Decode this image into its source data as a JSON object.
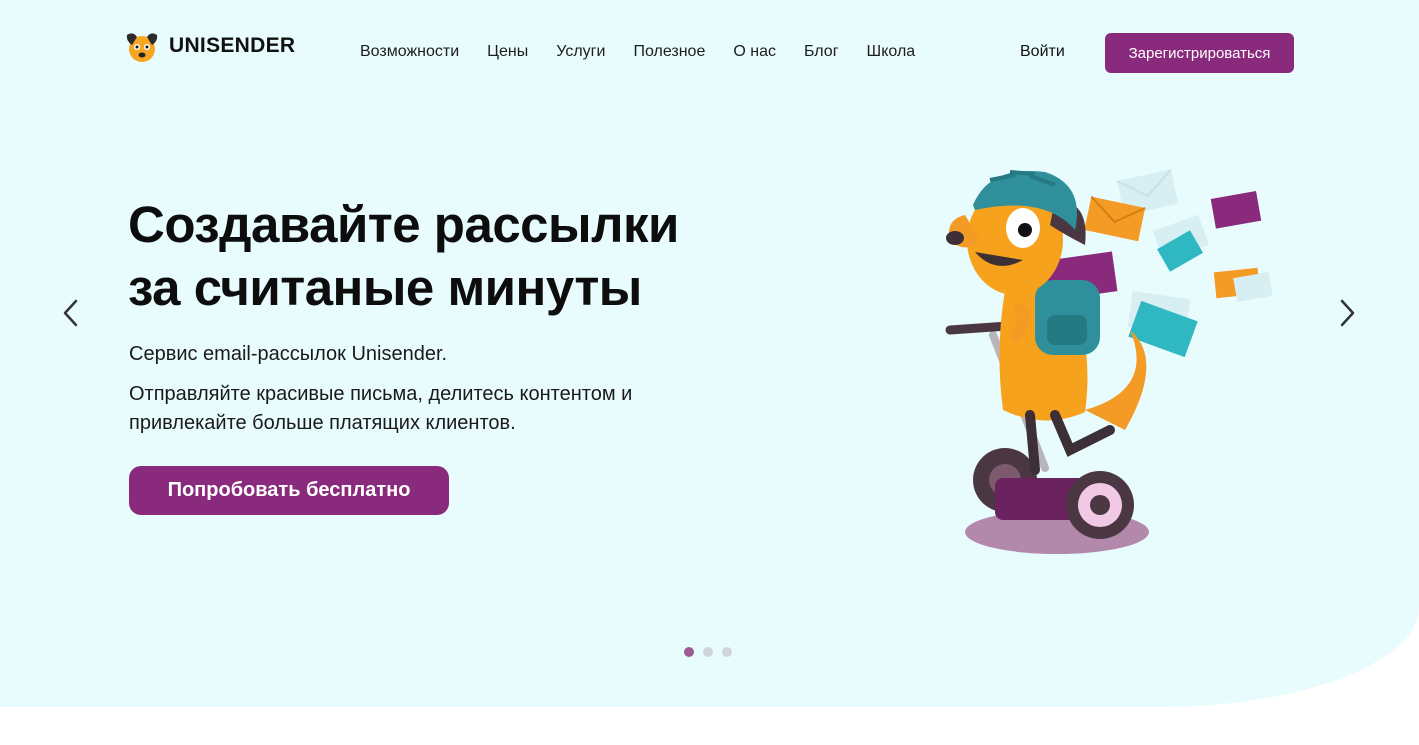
{
  "header": {
    "logo_text": "UNISENDER",
    "nav": [
      "Возможности",
      "Цены",
      "Услуги",
      "Полезное",
      "О нас",
      "Блог",
      "Школа"
    ],
    "login": "Войти",
    "signup": "Зарегистрироваться"
  },
  "hero": {
    "title_line1": "Создавайте рассылки",
    "title_line2": "за считаные минуты",
    "subtitle1": "Сервис email-рассылок Unisender.",
    "subtitle2": "Отправляйте красивые письма, делитесь контентом и привлекайте больше платящих клиентов.",
    "cta": "Попробовать бесплатно"
  },
  "carousel": {
    "active_slide": 1,
    "total_slides": 3
  },
  "icons": {
    "logo": "dog-logo-icon",
    "prev": "chevron-left-icon",
    "next": "chevron-right-icon",
    "illustration": "dog-on-segway-illustration"
  },
  "colors": {
    "brand": "#8a2a7c",
    "hero_bg": "#e8fbfd",
    "dot_active": "#9b5c92",
    "dot_inactive": "#cfd6d9"
  }
}
